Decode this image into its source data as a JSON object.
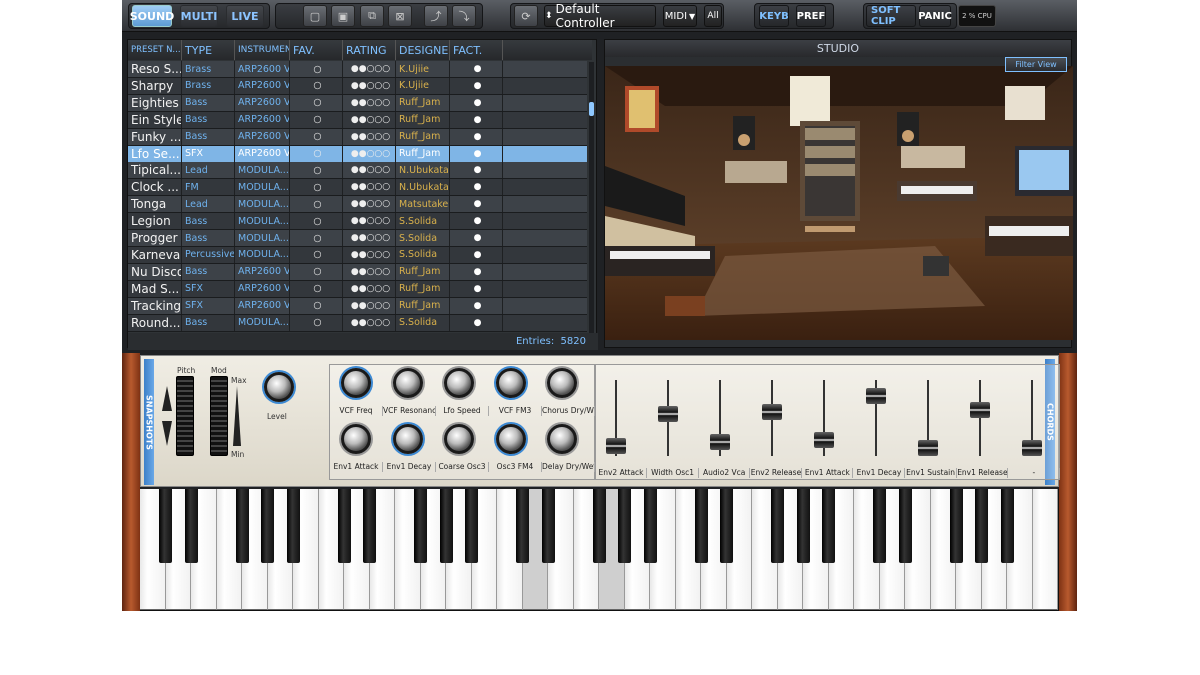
{
  "toolbar": {
    "tabs": [
      {
        "label": "SOUND"
      },
      {
        "label": "MULTI"
      },
      {
        "label": "LIVE"
      }
    ],
    "controller": "Default Controller",
    "midi": "MIDI",
    "all": "All",
    "keyb": "KEYB",
    "pref": "PREF",
    "softclip": "SOFT CLIP",
    "panic": "PANIC",
    "cpu": "2 % CPU"
  },
  "browser": {
    "columns": [
      "PRESET N...",
      "TYPE",
      "INSTRUMENT",
      "FAV.",
      "RATING",
      "DESIGNER",
      "FACT."
    ],
    "rows": [
      {
        "name": "Reso S...",
        "type": "Brass",
        "instrument": "ARP2600 V",
        "fav": "○",
        "rating": "●●○○○",
        "designer": "K.Ujiie",
        "fact": "●"
      },
      {
        "name": "Sharpy",
        "type": "Brass",
        "instrument": "ARP2600 V",
        "fav": "○",
        "rating": "●●○○○",
        "designer": "K.Ujiie",
        "fact": "●"
      },
      {
        "name": "Eighties",
        "type": "Bass",
        "instrument": "ARP2600 V",
        "fav": "○",
        "rating": "●●○○○",
        "designer": "Ruff_Jam",
        "fact": "●"
      },
      {
        "name": "Ein Style",
        "type": "Bass",
        "instrument": "ARP2600 V",
        "fav": "○",
        "rating": "●●○○○",
        "designer": "Ruff_Jam",
        "fact": "●"
      },
      {
        "name": "Funky ...",
        "type": "Bass",
        "instrument": "ARP2600 V",
        "fav": "○",
        "rating": "●●○○○",
        "designer": "Ruff_Jam",
        "fact": "●"
      },
      {
        "name": "Lfo Se...",
        "type": "SFX",
        "instrument": "ARP2600 V",
        "fav": "○",
        "rating": "●●○○○",
        "designer": "Ruff_Jam",
        "fact": "●"
      },
      {
        "name": "Tipical...",
        "type": "Lead",
        "instrument": "MODULA...",
        "fav": "○",
        "rating": "●●○○○",
        "designer": "N.Ubukata",
        "fact": "●"
      },
      {
        "name": "Clock ...",
        "type": "FM",
        "instrument": "MODULA...",
        "fav": "○",
        "rating": "●●○○○",
        "designer": "N.Ubukata",
        "fact": "●"
      },
      {
        "name": "Tonga",
        "type": "Lead",
        "instrument": "MODULA...",
        "fav": "○",
        "rating": "●●○○○",
        "designer": "Matsutake",
        "fact": "●"
      },
      {
        "name": "Legion",
        "type": "Bass",
        "instrument": "MODULA...",
        "fav": "○",
        "rating": "●●○○○",
        "designer": "S.Solida",
        "fact": "●"
      },
      {
        "name": "Progger",
        "type": "Bass",
        "instrument": "MODULA...",
        "fav": "○",
        "rating": "●●○○○",
        "designer": "S.Solida",
        "fact": "●"
      },
      {
        "name": "Karneval",
        "type": "Percussive",
        "instrument": "MODULA...",
        "fav": "○",
        "rating": "●●○○○",
        "designer": "S.Solida",
        "fact": "●"
      },
      {
        "name": "Nu Disco",
        "type": "Bass",
        "instrument": "ARP2600 V",
        "fav": "○",
        "rating": "●●○○○",
        "designer": "Ruff_Jam",
        "fact": "●"
      },
      {
        "name": "Mad S...",
        "type": "SFX",
        "instrument": "ARP2600 V",
        "fav": "○",
        "rating": "●●○○○",
        "designer": "Ruff_Jam",
        "fact": "●"
      },
      {
        "name": "Tracking",
        "type": "SFX",
        "instrument": "ARP2600 V",
        "fav": "○",
        "rating": "●●○○○",
        "designer": "Ruff_Jam",
        "fact": "●"
      },
      {
        "name": "Round...",
        "type": "Bass",
        "instrument": "MODULA...",
        "fav": "○",
        "rating": "●●○○○",
        "designer": "S.Solida",
        "fact": "●"
      }
    ],
    "entries_label": "Entries:",
    "entries_count": "5820"
  },
  "studio": {
    "title": "STUDIO",
    "filter_view": "Filter View"
  },
  "synth": {
    "snapshots": "SNAPSHOTS",
    "chords": "CHORDS",
    "pitch": "Pitch",
    "mod": "Mod",
    "max": "Max",
    "min": "Min",
    "level": "Level",
    "knobs_top": [
      "VCF Freq",
      "VCF Resonance",
      "Lfo Speed",
      "VCF FM3",
      "Chorus Dry/Wet"
    ],
    "knobs_bottom": [
      "Env1 Attack",
      "Env1 Decay",
      "Coarse Osc3",
      "Osc3 FM4",
      "Delay Dry/Wet"
    ],
    "sliders": [
      "Env2 Attack",
      "Width Osc1",
      "Audio2 Vca",
      "Env2 Release",
      "Env1 Attack",
      "Env1 Decay",
      "Env1 Sustain",
      "Env1 Release",
      "-"
    ]
  }
}
